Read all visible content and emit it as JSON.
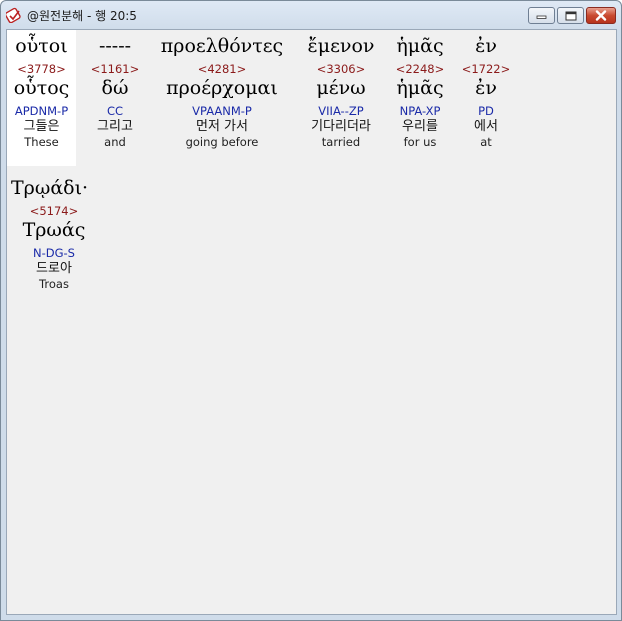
{
  "window": {
    "title": "@원전분해 - 행 20:5",
    "icon": "parse-tool-icon",
    "buttons": [
      "minimize",
      "maximize",
      "close"
    ]
  },
  "words": [
    {
      "orig": "οὗτοι",
      "strong": "<3778>",
      "lemma": "οὗτος",
      "morph": "APDNM-P",
      "korean": "그들은",
      "english": "These"
    },
    {
      "orig": "-----",
      "strong": "<1161>",
      "lemma": "δώ",
      "morph": "CC",
      "korean": "그리고",
      "english": "and"
    },
    {
      "orig": "προελθόντες",
      "strong": "<4281>",
      "lemma": "προέρχομαι",
      "morph": "VPAANM-P",
      "korean": "먼저 가서",
      "english": "going before"
    },
    {
      "orig": "ἔμενον",
      "strong": "<3306>",
      "lemma": "μένω",
      "morph": "VIIA--ZP",
      "korean": "기다리더라",
      "english": "tarried"
    },
    {
      "orig": "ἡμᾶς",
      "strong": "<2248>",
      "lemma": "ἡμᾶς",
      "morph": "NPA-XP",
      "korean": "우리를",
      "english": "for us"
    },
    {
      "orig": "ἐν",
      "strong": "<1722>",
      "lemma": "ἐν",
      "morph": "PD",
      "korean": "에서",
      "english": "at"
    },
    {
      "orig": "Τρῳάδι·",
      "strong": "<5174>",
      "lemma": "Τρωάς",
      "morph": "N-DG-S",
      "korean": "드로아",
      "english": "Troas"
    }
  ]
}
